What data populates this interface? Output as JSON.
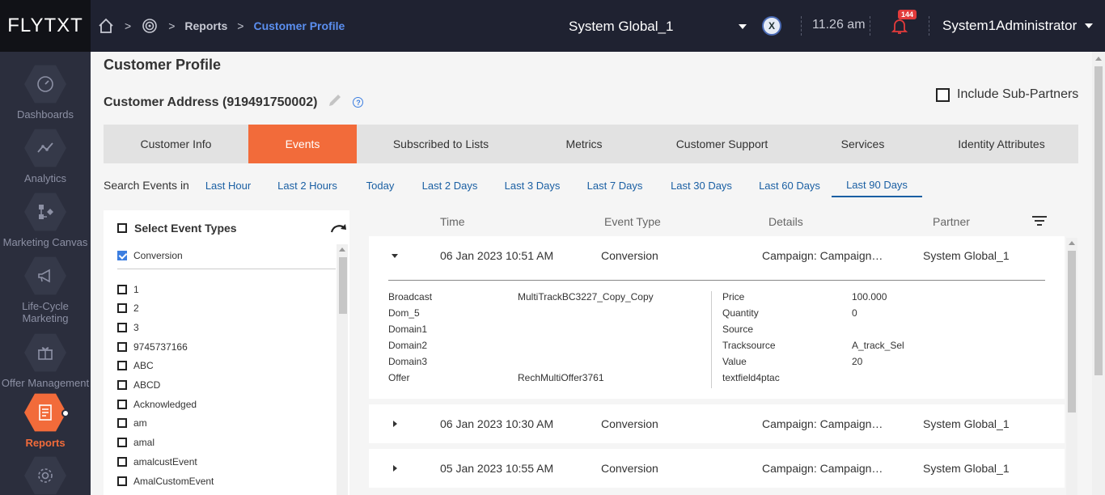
{
  "header": {
    "logo": "FLYTXT",
    "breadcrumb": {
      "reports": "Reports",
      "current": "Customer Profile"
    },
    "partner": "System Global_1",
    "time": "11.26 am",
    "notifications_count": "144",
    "user": "System1Administrator"
  },
  "sidebar": {
    "items": [
      {
        "label": "Dashboards"
      },
      {
        "label": "Analytics"
      },
      {
        "label": "Marketing Canvas"
      },
      {
        "label": "Life-Cycle Marketing"
      },
      {
        "label": "Offer Management"
      },
      {
        "label": "Reports"
      }
    ]
  },
  "page": {
    "title": "Customer Profile",
    "address": "Customer Address (919491750002)",
    "include_sub_partners": "Include Sub-Partners"
  },
  "tabs": [
    "Customer Info",
    "Events",
    "Subscribed to Lists",
    "Metrics",
    "Customer Support",
    "Services",
    "Identity Attributes"
  ],
  "active_tab": "Events",
  "search": {
    "label": "Search Events in",
    "ranges": [
      "Last Hour",
      "Last 2 Hours",
      "Today",
      "Last 2 Days",
      "Last 3 Days",
      "Last 7 Days",
      "Last 30 Days",
      "Last 60 Days",
      "Last 90 Days"
    ],
    "selected": "Last 90 Days"
  },
  "filter": {
    "select_label": "Select Event Types",
    "selected_type": "Conversion",
    "types": [
      "1",
      "2",
      "3",
      "9745737166",
      "ABC",
      "ABCD",
      "Acknowledged",
      "am",
      "amal",
      "amalcustEvent",
      "AmalCustomEvent"
    ]
  },
  "table": {
    "columns": [
      "Time",
      "Event Type",
      "Details",
      "Partner"
    ],
    "rows": [
      {
        "time": "06 Jan 2023 10:51 AM",
        "type": "Conversion",
        "details": "Campaign: Campaign…",
        "partner": "System Global_1"
      },
      {
        "time": "06 Jan 2023 10:30 AM",
        "type": "Conversion",
        "details": "Campaign: Campaign…",
        "partner": "System Global_1"
      },
      {
        "time": "05 Jan 2023 10:55 AM",
        "type": "Conversion",
        "details": "Campaign: Campaign…",
        "partner": "System Global_1"
      }
    ],
    "expanded_details": {
      "left": [
        {
          "key": "Broadcast",
          "value": "MultiTrackBC3227_Copy_Copy"
        },
        {
          "key": "Dom_5",
          "value": ""
        },
        {
          "key": "Domain1",
          "value": ""
        },
        {
          "key": "Domain2",
          "value": ""
        },
        {
          "key": "Domain3",
          "value": ""
        },
        {
          "key": "Offer",
          "value": "RechMultiOffer3761"
        }
      ],
      "right": [
        {
          "key": "Price",
          "value": "100.000"
        },
        {
          "key": "Quantity",
          "value": "0"
        },
        {
          "key": "Source",
          "value": ""
        },
        {
          "key": "Tracksource",
          "value": "A_track_Sel"
        },
        {
          "key": "Value",
          "value": "20"
        },
        {
          "key": "textfield4ptac",
          "value": ""
        }
      ]
    }
  },
  "colors": {
    "accent": "#f26b3a",
    "topbar": "#1f2231",
    "sidebar": "#2b2e3d",
    "link": "#1a5fa3"
  }
}
